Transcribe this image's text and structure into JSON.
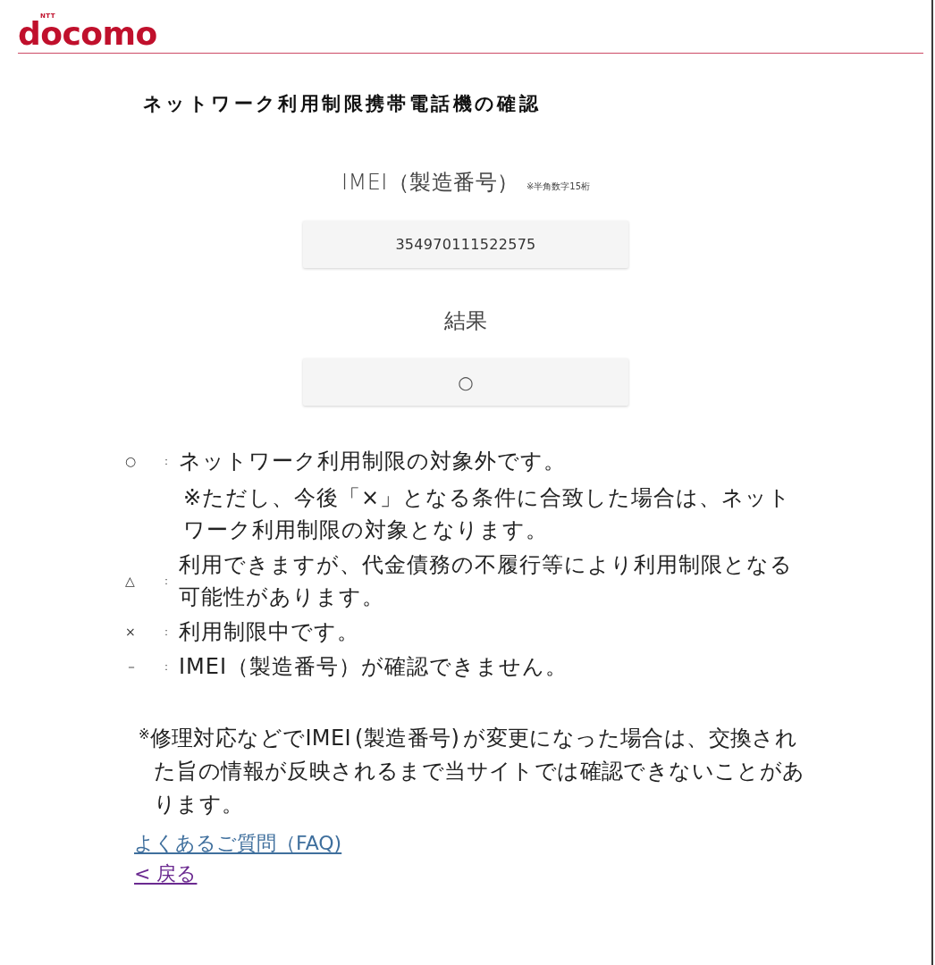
{
  "header": {
    "logo": {
      "caption": "NTT",
      "wordmark": "docomo"
    }
  },
  "title": "ネットワーク利用制限携帯電話機の確認",
  "imei": {
    "label": "IMEI（製造番号）",
    "hint": "※半角数字15桁",
    "value": "354970111522575"
  },
  "result": {
    "label": "結果",
    "value": "○"
  },
  "legend": [
    {
      "symbol": "○",
      "separator": "：",
      "text": "ネットワーク利用制限の対象外です。",
      "note": "※ただし、今後「×」となる条件に合致した場合は、ネットワーク利用制限の対象となります。"
    },
    {
      "symbol": "△",
      "separator": "：",
      "text": "利用できますが、代金債務の不履行等により利用制限となる可能性があります。"
    },
    {
      "symbol": "×",
      "separator": "：",
      "text": "利用制限中です。"
    },
    {
      "symbol": "－",
      "separator": "：",
      "text": "IMEI（製造番号）が確認できません。"
    }
  ],
  "footnote": "$^{※}$修理対応などでIMEI (製造番号) が変更になった場合は、交換された旨の情報が反映されるまで当サイトでは確認できないことがあります。",
  "links": [
    {
      "label": "よくあるご質問（FAQ)",
      "visited": false
    },
    {
      "label": "< 戻る",
      "visited": true
    }
  ]
}
